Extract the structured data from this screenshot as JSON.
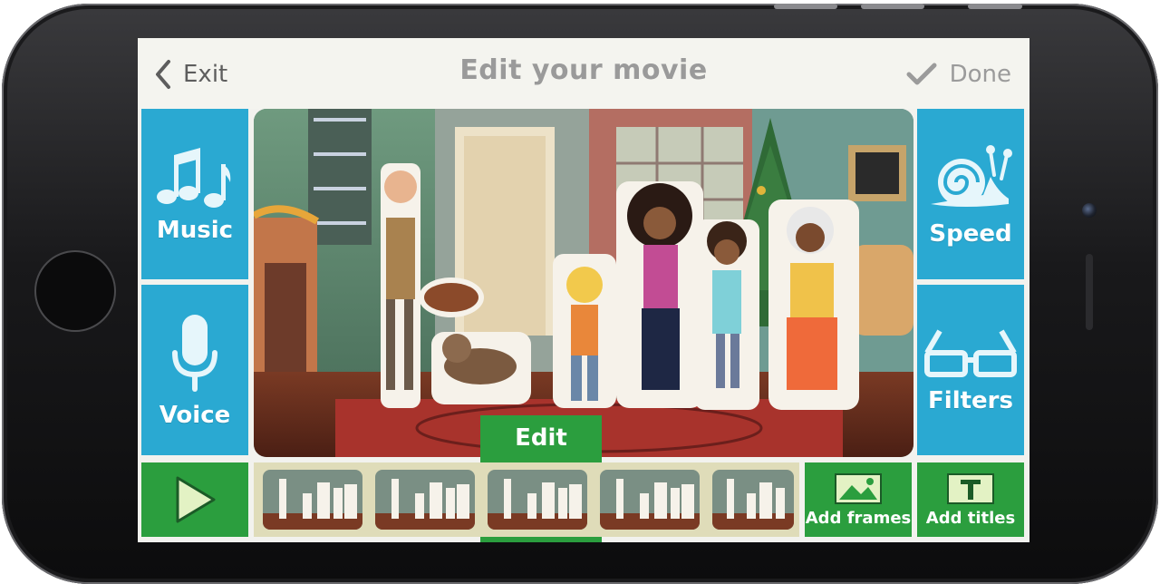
{
  "header": {
    "exit_label": "Exit",
    "title": "Edit your movie",
    "done_label": "Done"
  },
  "left_tools": [
    {
      "label": "Music",
      "icon": "music-notes-icon"
    },
    {
      "label": "Voice",
      "icon": "microphone-icon"
    }
  ],
  "right_tools": [
    {
      "label": "Speed",
      "icon": "snail-icon"
    },
    {
      "label": "Filters",
      "icon": "3d-glasses-icon"
    }
  ],
  "timeline": {
    "edit_label": "Edit",
    "play_icon": "play-icon",
    "add_frames_label": "Add frames",
    "add_frames_icon": "image-icon",
    "add_titles_label": "Add titles",
    "add_titles_icon": "text-icon"
  },
  "colors": {
    "tool_blue": "#2aa9d2",
    "action_green": "#2b9e3e",
    "filmstrip_bg": "#dfdcb9"
  }
}
